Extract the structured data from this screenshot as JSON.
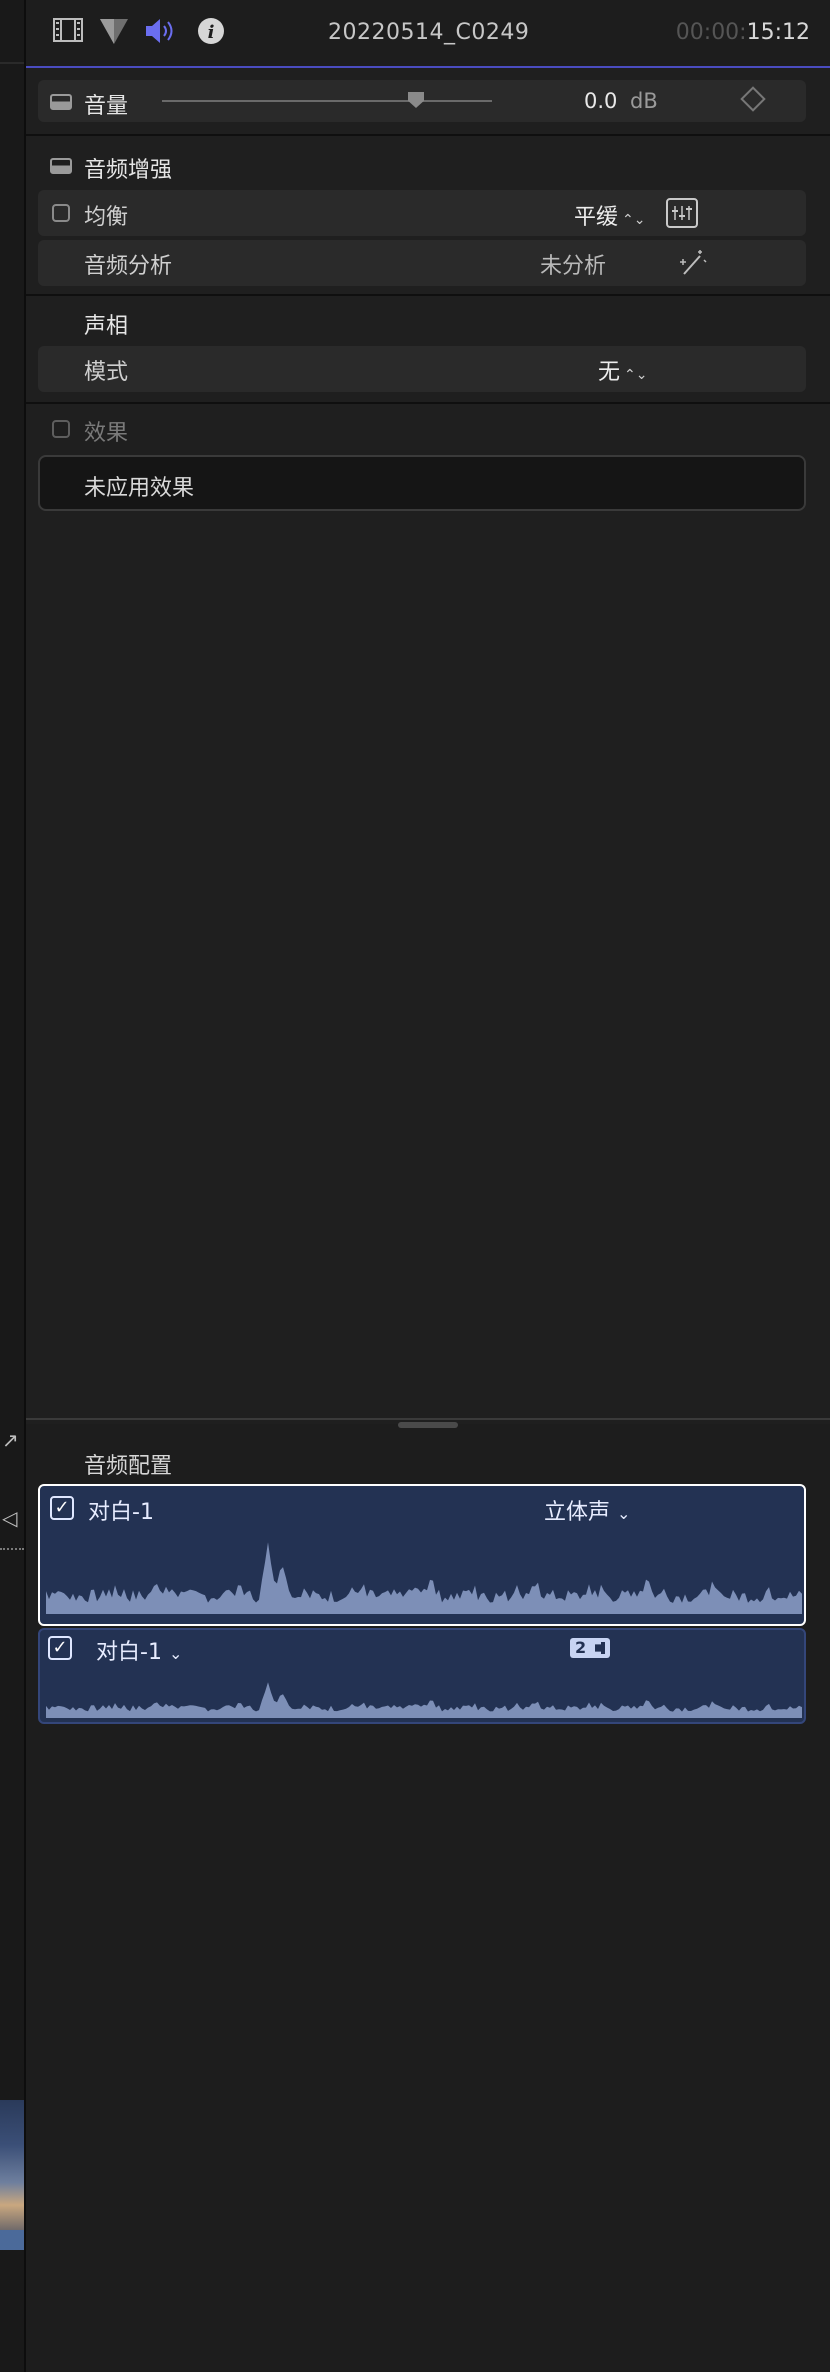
{
  "header": {
    "title": "20220514_C0249",
    "time_dim": "00:00:",
    "time_bright": "15:12",
    "icons": [
      "film-icon",
      "color-triangle-icon",
      "speaker-icon",
      "info-icon"
    ]
  },
  "volume": {
    "label": "音量",
    "value": "0.0",
    "unit": "dB",
    "slider_level": 0.78
  },
  "enhance": {
    "title": "音频增强",
    "eq_label": "均衡",
    "eq_value": "平缓",
    "analysis_label": "音频分析",
    "analysis_value": "未分析"
  },
  "pan": {
    "title": "声相",
    "mode_label": "模式",
    "mode_value": "无"
  },
  "effects": {
    "label": "效果",
    "empty_text": "未应用效果"
  },
  "audio_config": {
    "title": "音频配置",
    "clips": [
      {
        "name": "对白-1",
        "channel": "立体声"
      },
      {
        "name": "对白-1",
        "badge": "2"
      }
    ]
  },
  "colors": {
    "accent": "#4a4cc0",
    "clip_bg": "#233253",
    "wave": "#7d8fb7"
  }
}
